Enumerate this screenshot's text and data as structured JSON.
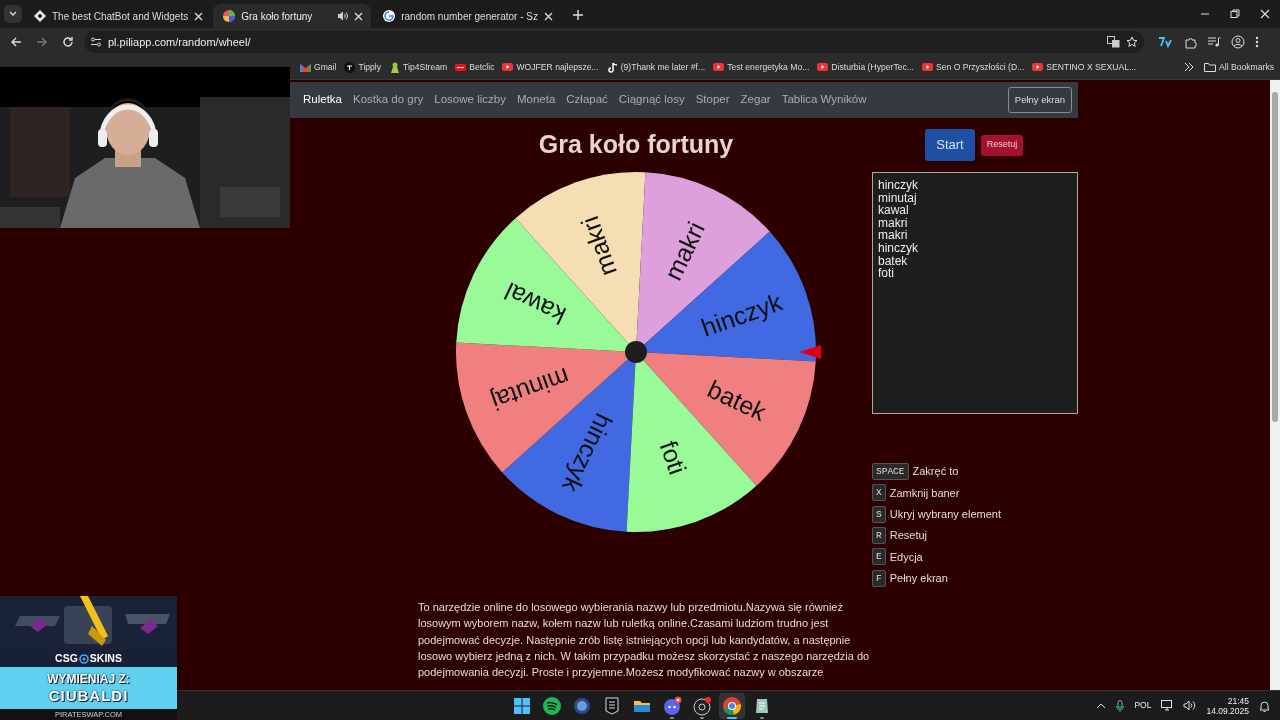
{
  "browser": {
    "tabs": [
      {
        "title": "The best ChatBot and Widgets",
        "selected": false,
        "audio": false
      },
      {
        "title": "Gra koło fortuny",
        "selected": true,
        "audio": true
      },
      {
        "title": "random number generator - Sz",
        "selected": false,
        "audio": false
      }
    ],
    "navigation": {
      "back_disabled": false,
      "forward_disabled": true
    },
    "address": "pl.piliapp.com/random/wheel/",
    "bookmarks": [
      {
        "label": "Gmail"
      },
      {
        "label": "Tipply"
      },
      {
        "label": "Tip4Stream"
      },
      {
        "label": "Betclic"
      },
      {
        "label": "WOJFER najlepsze..."
      },
      {
        "label": "(9)Thank me later #f..."
      },
      {
        "label": "Test energetyka Mo..."
      },
      {
        "label": "Disturbia (HyperTec..."
      },
      {
        "label": "Sen O Przyszłości (D..."
      },
      {
        "label": "SENTINO X SEXUAL..."
      }
    ],
    "all_bookmarks": "All Bookmarks"
  },
  "navbar": {
    "items": [
      {
        "label": "Ruletka",
        "selected": true
      },
      {
        "label": "Kostka do gry",
        "selected": false
      },
      {
        "label": "Losowe liczby",
        "selected": false
      },
      {
        "label": "Moneta",
        "selected": false
      },
      {
        "label": "Człapać",
        "selected": false
      },
      {
        "label": "Ciągnąć losy",
        "selected": false
      },
      {
        "label": "Stoper",
        "selected": false
      },
      {
        "label": "Zegar",
        "selected": false
      },
      {
        "label": "Tablica Wyników",
        "selected": false
      }
    ],
    "fullscreen_button": "Pełny ekran"
  },
  "title": "Gra koło fortuny",
  "buttons": {
    "start": "Start",
    "reset": "Resetuj"
  },
  "wheel": {
    "segments": [
      {
        "label": "hinczyk",
        "color": "#4169e1"
      },
      {
        "label": "minutaj",
        "color": "#f08080"
      },
      {
        "label": "kawal",
        "color": "#98fb98"
      },
      {
        "label": "makri",
        "color": "#f5deb3"
      },
      {
        "label": "makri",
        "color": "#dda0dd"
      },
      {
        "label": "hinczyk",
        "color": "#4169e1"
      },
      {
        "label": "batek",
        "color": "#f08080"
      },
      {
        "label": "foti",
        "color": "#98fb98"
      }
    ]
  },
  "entries_text": "hinczyk\nminutaj\nkawal\nmakri\nmakri\nhinczyk\nbatek\nfoti",
  "shortcuts": [
    {
      "key": "SPACE",
      "label": "Zakręć to"
    },
    {
      "key": "X",
      "label": "Zamknij baner"
    },
    {
      "key": "S",
      "label": "Ukryj wybrany element"
    },
    {
      "key": "R",
      "label": "Resetuj"
    },
    {
      "key": "E",
      "label": "Edycja"
    },
    {
      "key": "F",
      "label": "Pełny ekran"
    }
  ],
  "description": "To narzędzie online do losowego wybierania nazwy lub przedmiotu.Nazywa się również\nlosowym wyborem nazw, kołem nazw lub ruletką online.Czasami ludziom trudno jest\npodejmować decyzje. Następnie zrób listę istniejących opcji lub kandydatów, a następnie\nlosowo wybierz jedną z nich. W takim przypadku możesz skorzystać z naszego narzędzia do\npodejmowania decyzji. Proste i przyjemne.Możesz modyfikować nazwy w obszarze",
  "overlays": {
    "ad": {
      "brand_left": "CSG",
      "brand_right": "SKINS",
      "headline": "WYMIENIAJ Z:",
      "name": "CIUBALDI",
      "site": "PIRATESWAP.COM"
    }
  },
  "taskbar": {
    "apps": [
      {
        "running": false,
        "active": false
      },
      {
        "running": false,
        "active": false
      },
      {
        "running": false,
        "active": false
      },
      {
        "running": false,
        "active": false
      },
      {
        "running": false,
        "active": false
      },
      {
        "running": true,
        "active": false
      },
      {
        "running": true,
        "active": false
      },
      {
        "running": true,
        "active": true
      },
      {
        "running": true,
        "active": false
      }
    ],
    "language": "POL",
    "time": "21:45",
    "date": "14.09.2025"
  }
}
